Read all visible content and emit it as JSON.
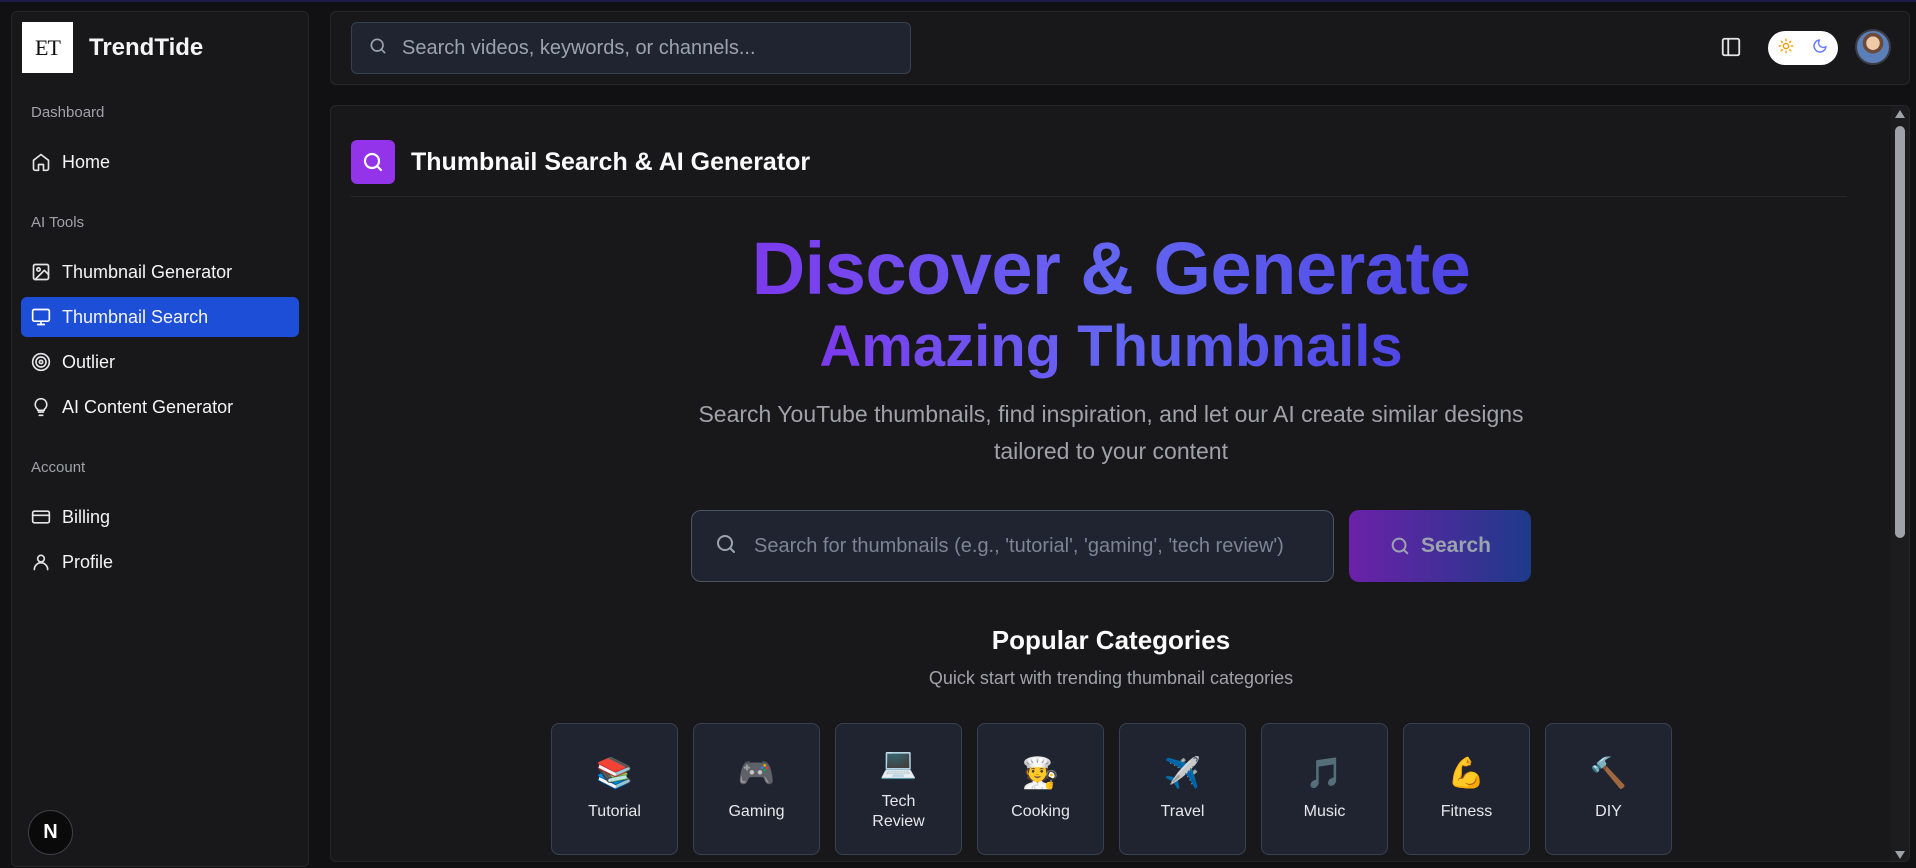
{
  "brand": {
    "logo_text": "ET",
    "name": "TrendTide"
  },
  "sidebar": {
    "groups": [
      {
        "label": "Dashboard"
      },
      {
        "label": "AI Tools"
      },
      {
        "label": "Account"
      }
    ],
    "items": [
      {
        "label": "Home",
        "icon": "home-icon"
      },
      {
        "label": "Thumbnail Generator",
        "icon": "image-icon"
      },
      {
        "label": "Thumbnail Search",
        "icon": "monitor-icon",
        "active": true
      },
      {
        "label": "Outlier",
        "icon": "target-icon"
      },
      {
        "label": "AI Content Generator",
        "icon": "lightbulb-icon"
      },
      {
        "label": "Billing",
        "icon": "credit-card-icon"
      },
      {
        "label": "Profile",
        "icon": "user-icon"
      }
    ],
    "badge": "N"
  },
  "header": {
    "search_placeholder": "Search videos, keywords, or channels...",
    "theme": "light"
  },
  "page": {
    "title": "Thumbnail Search & AI Generator",
    "hero_line1": "Discover & Generate",
    "hero_line2": "Amazing Thumbnails",
    "hero_sub": "Search YouTube thumbnails, find inspiration, and let our AI create similar designs tailored to your content",
    "search_placeholder": "Search for thumbnails (e.g., 'tutorial', 'gaming', 'tech review')",
    "search_button": "Search",
    "categories_title": "Popular Categories",
    "categories_sub": "Quick start with trending thumbnail categories",
    "categories": [
      {
        "emoji": "📚",
        "label": "Tutorial"
      },
      {
        "emoji": "🎮",
        "label": "Gaming"
      },
      {
        "emoji": "💻",
        "label": "Tech Review"
      },
      {
        "emoji": "🧑‍🍳",
        "label": "Cooking"
      },
      {
        "emoji": "✈️",
        "label": "Travel"
      },
      {
        "emoji": "🎵",
        "label": "Music"
      },
      {
        "emoji": "💪",
        "label": "Fitness"
      },
      {
        "emoji": "🔨",
        "label": "DIY"
      }
    ]
  },
  "colors": {
    "active_nav": "#1d4ed8",
    "accent_purple": "#9333ea",
    "gradient_start": "#7c3aed",
    "gradient_end": "#4f46e5"
  }
}
